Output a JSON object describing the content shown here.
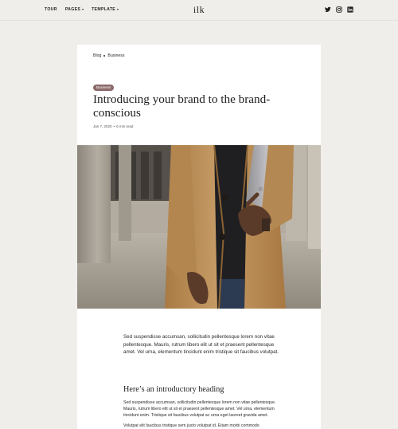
{
  "nav": {
    "tour": "TOUR",
    "pages": "PAGES",
    "template": "TEMPLATE",
    "logo": "ilk",
    "social": [
      "twitter-icon",
      "instagram-icon",
      "linkedin-icon"
    ]
  },
  "breadcrumb": {
    "blog": "Blog",
    "business": "Business"
  },
  "article": {
    "badge": "Business",
    "title": "Introducing your brand to the brand-conscious",
    "date": "Jan 7, 2020",
    "separator": "•",
    "read_time": "6 min read",
    "intro": "Sed suspendisse accumsan, sollicitudin pellentesque lorem non vitae pellentesque. Mauris, rutrum libero elit ut sit et praesent pellentesque amet. Vel urna, elementum tincidunt enim tristique sit faucibus volutpat.",
    "heading": "Here’s an introductory heading",
    "paragraph2": "Sed suspendisse accumsan, sollicitudin pellentesque lorem non vitae pellentesque. Mauris, rutrum libero elit ut sit et praesent pellentesque amet. Vel urna, elementum tincidunt enim. Tristique sit faucibus volutpat ac urna eget laoreet gravida amet.",
    "paragraph3": "Volutpat elit faucibus tristique sem justo volutpat id. Etiam morbi commodo"
  },
  "colors": {
    "background": "#efeeea",
    "card": "#ffffff",
    "badge": "#8c6a6a",
    "coat": "#c29660"
  }
}
